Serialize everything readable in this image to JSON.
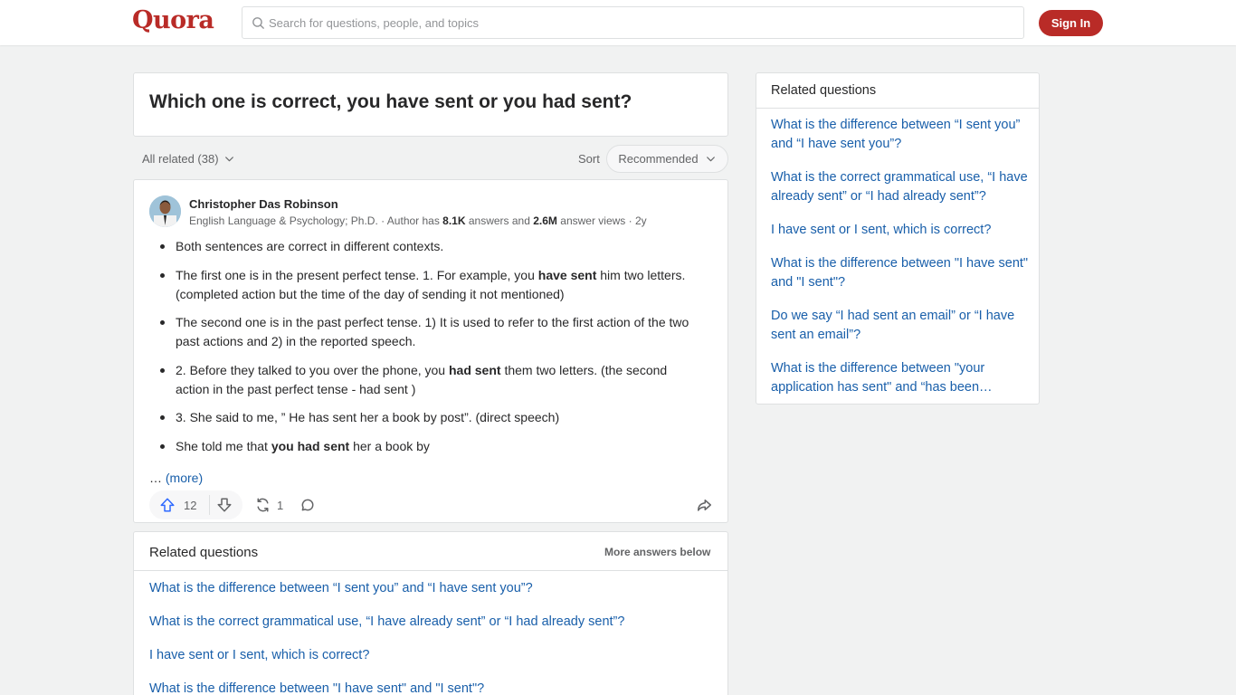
{
  "header": {
    "logo": "Quora",
    "search_placeholder": "Search for questions, people, and topics",
    "signin_label": "Sign In"
  },
  "question": {
    "title": "Which one is correct, you have sent or you had sent?"
  },
  "filters": {
    "all_related": "All related (38)",
    "sort_label": "Sort",
    "sort_value": "Recommended"
  },
  "answer": {
    "author_name": "Christopher Das Robinson",
    "credential_prefix": "English Language & Psychology; Ph.D. · Author has ",
    "answers_count": "8.1K",
    "answers_mid": " answers and ",
    "views_count": "2.6M",
    "views_suffix": " answer views · 2y",
    "bullets": [
      {
        "pre": "Both sentences are correct in different contexts.",
        "bold": "",
        "post": ""
      },
      {
        "pre": "The first one is in the present perfect tense. 1. For example, you ",
        "bold": "have sent",
        "post": " him two letters. (completed action but the time of the day of sending it not mentioned)"
      },
      {
        "pre": "The second one is in the past perfect tense. 1) It is used to refer to the first action of the two past actions and 2) in the reported speech.",
        "bold": "",
        "post": ""
      },
      {
        "pre": "2. Before they talked to you over the phone, you ",
        "bold": "had sent",
        "post": " them two letters. (the second action in the past perfect tense - had sent )"
      },
      {
        "pre": "3. She said to me, ” He has sent her a book by post”. (direct speech)",
        "bold": "",
        "post": ""
      },
      {
        "pre": "She told me that ",
        "bold": "you had sent",
        "post": " her a book by"
      }
    ],
    "ellipsis": "… ",
    "more_label": "(more)",
    "upvotes": "12",
    "shares": "1"
  },
  "related_bottom": {
    "heading": "Related questions",
    "more_label": "More answers below",
    "links": [
      "What is the difference between “I sent you” and “I have sent you”?",
      "What is the correct grammatical use, “I have already sent” or “I had already sent”?",
      "I have sent or I sent, which is correct?",
      "What is the difference between \"I have sent\" and \"I sent\"?"
    ]
  },
  "sidebar": {
    "heading": "Related questions",
    "links": [
      "What is the difference between “I sent you” and “I have sent you”?",
      "What is the correct grammatical use, “I have already sent” or “I had already sent”?",
      "I have sent or I sent, which is correct?",
      "What is the difference between \"I have sent\" and \"I sent\"?",
      "Do we say “I had sent an email” or “I have sent an email”?",
      "What is the difference between \"your application has sent\" and “has been…"
    ]
  },
  "colors": {
    "brand": "#b92b27",
    "link": "#195faa",
    "upvote": "#2e69ff"
  },
  "icons": [
    "search-icon",
    "chevron-down-icon",
    "upvote-icon",
    "downvote-icon",
    "share-icon",
    "comment-icon",
    "forward-icon"
  ]
}
